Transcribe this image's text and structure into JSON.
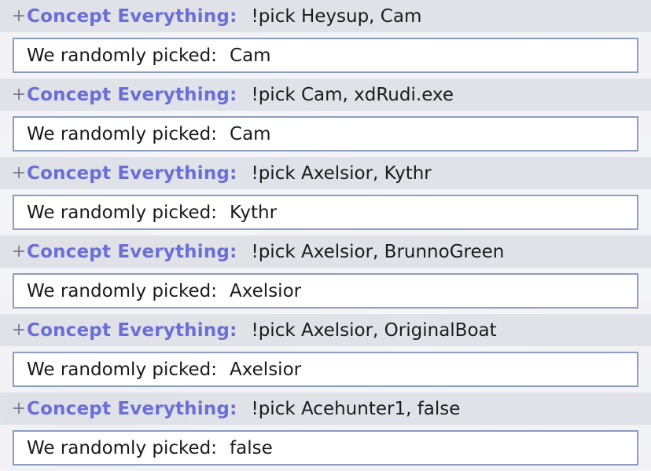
{
  "messages": [
    {
      "user": "Concept Everything:",
      "command": "!pick Heysup, Cam",
      "reply_label": "We randomly picked:",
      "reply_value": "Cam"
    },
    {
      "user": "Concept Everything:",
      "command": "!pick Cam, xdRudi.exe",
      "reply_label": "We randomly picked:",
      "reply_value": "Cam"
    },
    {
      "user": "Concept Everything:",
      "command": "!pick Axelsior, Kythr",
      "reply_label": "We randomly picked:",
      "reply_value": "Kythr"
    },
    {
      "user": "Concept Everything:",
      "command": "!pick Axelsior, BrunnoGreen",
      "reply_label": "We randomly picked:",
      "reply_value": "Axelsior"
    },
    {
      "user": "Concept Everything:",
      "command": "!pick Axelsior, OriginalBoat",
      "reply_label": "We randomly picked:",
      "reply_value": "Axelsior"
    },
    {
      "user": "Concept Everything:",
      "command": "!pick Acehunter1, false",
      "reply_label": "We randomly picked:",
      "reply_value": "false"
    }
  ],
  "expand_symbol": "+",
  "colors": {
    "username": "#6a6fd6",
    "reply_border": "#8e9cc0",
    "command_row_bg": "#dee1e7"
  }
}
